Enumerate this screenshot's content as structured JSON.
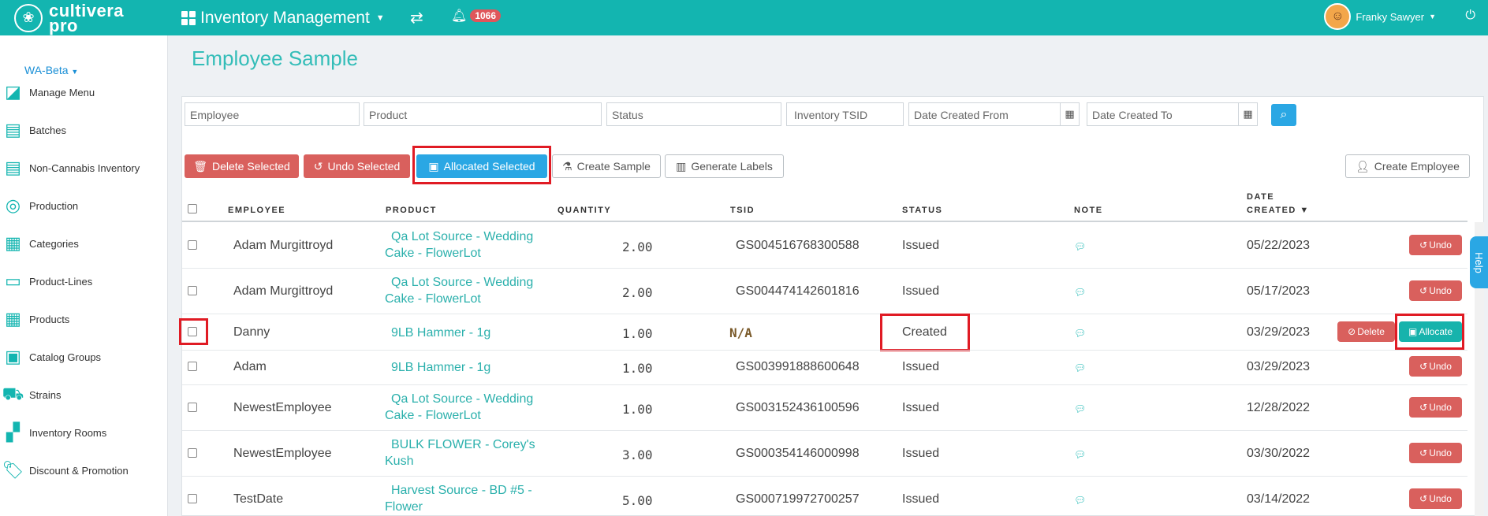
{
  "app": {
    "logo_line1": "cultivera",
    "logo_line2": "pro",
    "nav_title": "Inventory Management",
    "notifications_count": "1066",
    "user_name": "Franky Sawyer"
  },
  "sidebar": {
    "environment": "WA-Beta",
    "items": [
      {
        "label": "Manage Menu",
        "icon": "menu-icon"
      },
      {
        "label": "Batches",
        "icon": "batches-icon"
      },
      {
        "label": "Non-Cannabis Inventory",
        "icon": "inventory-icon"
      },
      {
        "label": "Production",
        "icon": "production-icon"
      },
      {
        "label": "Categories",
        "icon": "table-icon"
      },
      {
        "label": "Product-Lines",
        "icon": "product-lines-icon"
      },
      {
        "label": "Products",
        "icon": "products-grid-icon"
      },
      {
        "label": "Catalog Groups",
        "icon": "catalog-icon"
      },
      {
        "label": "Strains",
        "icon": "truck-icon"
      },
      {
        "label": "Inventory Rooms",
        "icon": "rooms-icon"
      },
      {
        "label": "Discount & Promotion",
        "icon": "tag-icon"
      }
    ]
  },
  "page": {
    "title": "Employee Sample"
  },
  "filters": {
    "employee": "Employee",
    "product": "Product",
    "status": "Status",
    "tsid": "Inventory TSID",
    "date_from": "Date Created From",
    "date_to": "Date Created To"
  },
  "toolbar": {
    "delete_selected": "Delete Selected",
    "undo_selected": "Undo Selected",
    "allocated_selected": "Allocated Selected",
    "create_sample": "Create Sample",
    "generate_labels": "Generate Labels",
    "create_employee": "Create Employee"
  },
  "table": {
    "headers": {
      "employee": "EMPLOYEE",
      "product": "PRODUCT",
      "quantity": "QUANTITY",
      "tsid": "TSID",
      "status": "STATUS",
      "note": "NOTE",
      "date_line1": "DATE",
      "date_line2": "CREATED ▼"
    },
    "rows": [
      {
        "employee": "Adam Murgittroyd",
        "product_l1": "Qa Lot Source - Wedding",
        "product_l2": "Cake - FlowerLot",
        "quantity": "2.00",
        "tsid": "GS004516768300588",
        "status": "Issued",
        "date": "05/22/2023",
        "action": "Undo"
      },
      {
        "employee": "Adam Murgittroyd",
        "product_l1": "Qa Lot Source - Wedding",
        "product_l2": "Cake - FlowerLot",
        "quantity": "2.00",
        "tsid": "GS004474142601816",
        "status": "Issued",
        "date": "05/17/2023",
        "action": "Undo"
      },
      {
        "employee": "Danny",
        "product_l1": "9LB Hammer - 1g",
        "product_l2": "",
        "quantity": "1.00",
        "tsid": "N/A",
        "status": "Created",
        "date": "03/29/2023",
        "action": "Allocate",
        "action2": "Delete"
      },
      {
        "employee": "Adam",
        "product_l1": "9LB Hammer - 1g",
        "product_l2": "",
        "quantity": "1.00",
        "tsid": "GS003991888600648",
        "status": "Issued",
        "date": "03/29/2023",
        "action": "Undo"
      },
      {
        "employee": "NewestEmployee",
        "product_l1": "Qa Lot Source - Wedding",
        "product_l2": "Cake - FlowerLot",
        "quantity": "1.00",
        "tsid": "GS003152436100596",
        "status": "Issued",
        "date": "12/28/2022",
        "action": "Undo"
      },
      {
        "employee": "NewestEmployee",
        "product_l1": "BULK FLOWER - Corey's",
        "product_l2": "Kush",
        "quantity": "3.00",
        "tsid": "GS000354146000998",
        "status": "Issued",
        "date": "03/30/2022",
        "action": "Undo"
      },
      {
        "employee": "TestDate",
        "product_l1": "Harvest Source - BD #5 -",
        "product_l2": "Flower",
        "quantity": "5.00",
        "tsid": "GS000719972700257",
        "status": "Issued",
        "date": "03/14/2022",
        "action": "Undo"
      }
    ]
  },
  "help_label": "Help",
  "colors": {
    "brand": "#13b5b0",
    "primary": "#2aa7e4",
    "danger": "#d9605d",
    "highlight": "#e01b24"
  }
}
